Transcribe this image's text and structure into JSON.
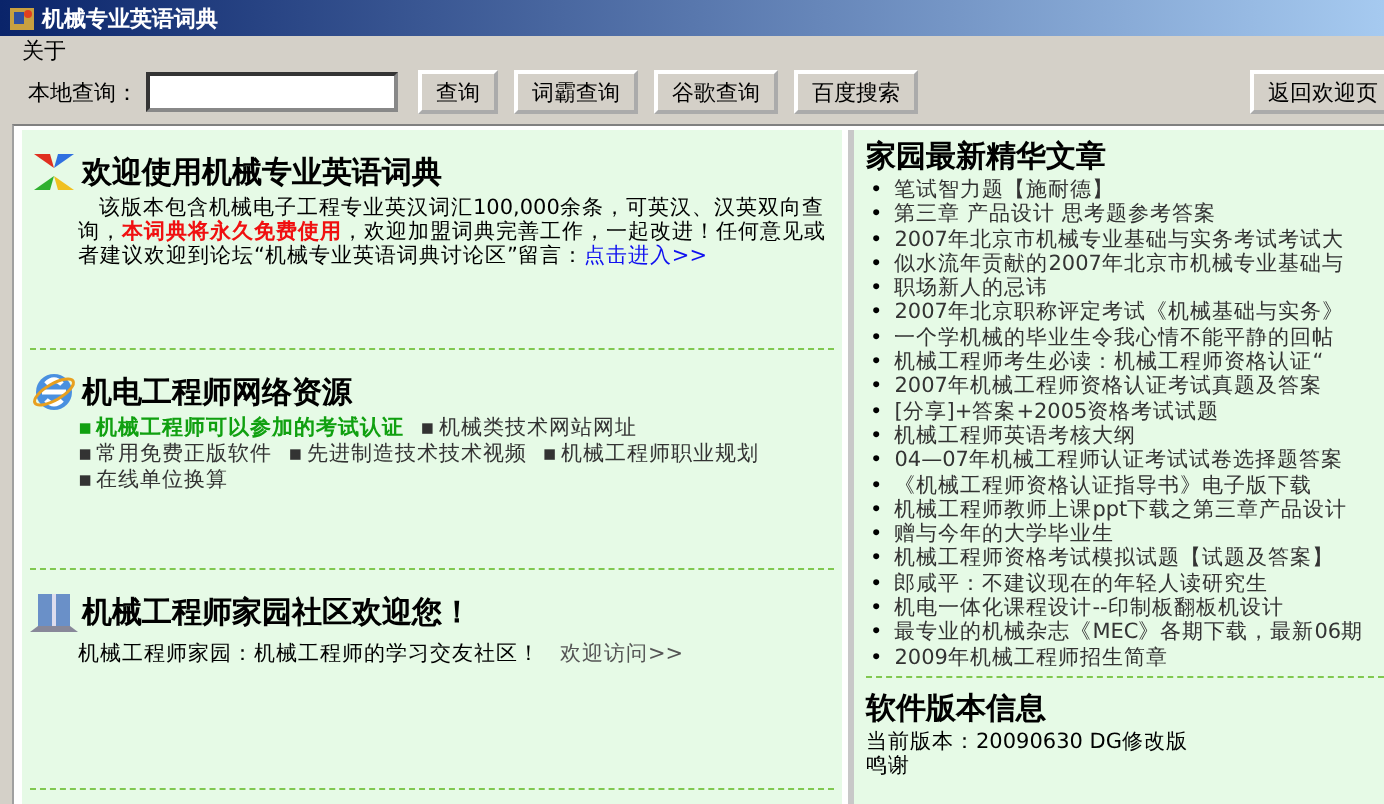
{
  "window": {
    "title": "机械专业英语词典"
  },
  "menu": [
    "关于"
  ],
  "toolbar": {
    "label": "本地查询：",
    "buttons": [
      "查询",
      "词霸查询",
      "谷歌查询",
      "百度搜索"
    ],
    "back_button": "返回欢迎页"
  },
  "sections": [
    {
      "kind": "intro",
      "title": "欢迎使用机械专业英语词典",
      "text": "该版本包含机械电子工程专业英汉词汇100,000余条，可英汉、汉英双向查询，",
      "highlight": "本词典将永久免费使用",
      "rest": "，欢迎加盟词典完善工作，一起改进！任何意见或者建议欢迎到论坛“机械专业英语词典讨论区”留言：",
      "link": "点击进入>>"
    },
    {
      "kind": "links",
      "title": "机电工程师网络资源",
      "marker": "▪",
      "links": [
        {
          "text": "机械工程师可以参加的考试认证",
          "highlight": true
        },
        {
          "text": "机械类技术网站网址",
          "highlight": false
        },
        {
          "text": "常用免费正版软件",
          "highlight": false
        },
        {
          "text": "先进制造技术技术视频",
          "highlight": false
        },
        {
          "text": "机械工程师职业规划",
          "highlight": false
        },
        {
          "text": "在线单位换算",
          "highlight": false
        }
      ]
    },
    {
      "kind": "community",
      "title": "机械工程师家园社区欢迎您！",
      "text": "机械工程师家园：机械工程师的学习交友社区！",
      "link": "欢迎访问>>"
    }
  ],
  "articles": {
    "title": "家园最新精华文章",
    "marker": "•",
    "items": [
      "笔试智力题【施耐德】",
      "第三章 产品设计 思考题参考答案",
      "2007年北京市机械专业基础与实务考试考试大",
      "似水流年贡献的2007年北京市机械专业基础与",
      "职场新人的忌讳",
      "2007年北京职称评定考试《机械基础与实务》",
      "一个学机械的毕业生令我心情不能平静的回帖",
      "机械工程师考生必读：机械工程师资格认证“",
      "2007年机械工程师资格认证考试真题及答案",
      "[分享]+答案+2005资格考试试题",
      "机械工程师英语考核大纲",
      "04—07年机械工程师认证考试试卷选择题答案",
      "《机械工程师资格认证指导书》电子版下载",
      "机械工程师教师上课ppt下载之第三章产品设计",
      "赠与今年的大学毕业生",
      "机械工程师资格考试模拟试题【试题及答案】",
      "郎咸平：不建议现在的年轻人读研究生",
      "机电一体化课程设计--印制板翻板机设计",
      "最专业的机械杂志《MEC》各期下载，最新06期",
      "2009年机械工程师招生简章"
    ]
  },
  "version": {
    "title": "软件版本信息",
    "lines": [
      "当前版本：20090630 DG修改版",
      "鸣谢"
    ]
  }
}
